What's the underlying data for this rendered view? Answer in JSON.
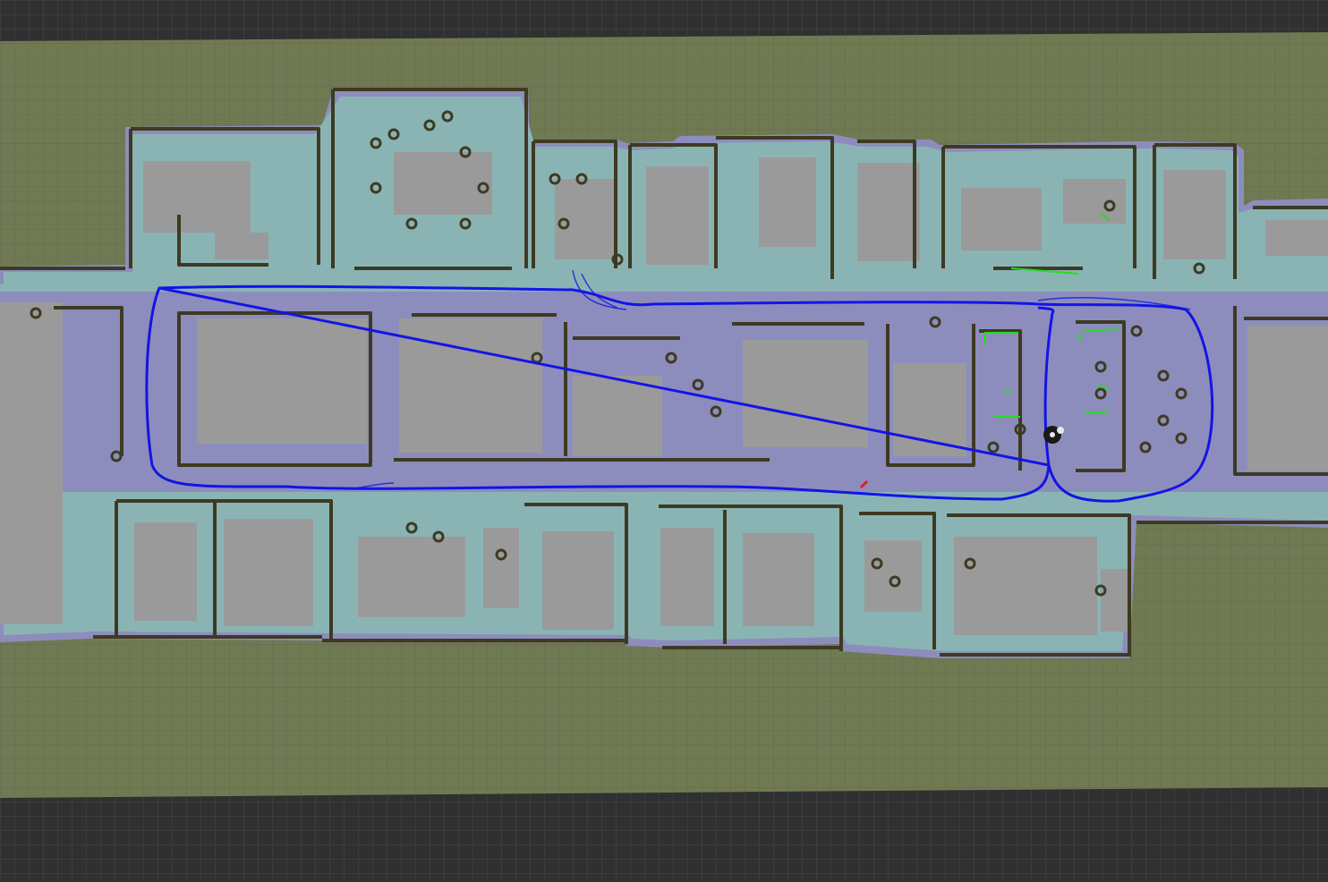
{
  "app": {
    "view": "3D map viewport",
    "title": ""
  },
  "colors": {
    "background": "#303030",
    "grid_line": "#5a5a5a",
    "map_unknown": "#707a52",
    "free_space": "#9a9a9a",
    "inflation_outer": "#8d8dbd",
    "inflation_inner": "#8ab4b4",
    "obstacle": "#3e3a22",
    "path": "#1414e6",
    "laser_points": "#22dd22",
    "goal_marker": "#e02020",
    "robot": "#1a1a1a"
  },
  "icons": {
    "robot": "robot-model-icon",
    "goal": "goal-arrow-icon"
  },
  "layers": [
    {
      "name": "grid",
      "visible": true
    },
    {
      "name": "occupancy-map",
      "visible": true
    },
    {
      "name": "costmap",
      "visible": true
    },
    {
      "name": "global-path",
      "visible": true
    },
    {
      "name": "laser-scan",
      "visible": true
    },
    {
      "name": "robot-model",
      "visible": true
    }
  ]
}
